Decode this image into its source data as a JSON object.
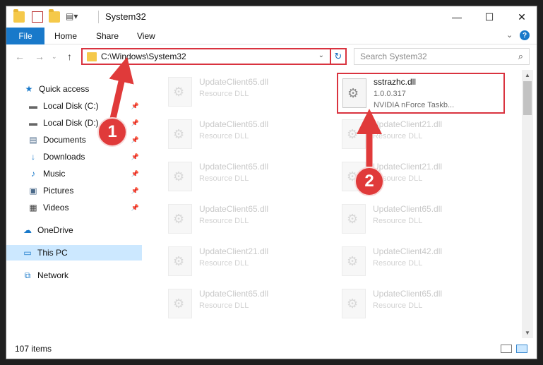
{
  "window": {
    "title": "System32"
  },
  "ribbon": {
    "tabs": [
      "File",
      "Home",
      "Share",
      "View"
    ],
    "help": "?"
  },
  "address": {
    "path": "C:\\Windows\\System32",
    "refresh": "↻"
  },
  "search": {
    "placeholder": "Search System32"
  },
  "sidebar": {
    "items": [
      {
        "label": "Quick access",
        "icon": "star-icon",
        "glyph": "★",
        "color": "#1979ca"
      },
      {
        "label": "Local Disk (C:)",
        "icon": "drive-icon",
        "glyph": "▬",
        "color": "#666666"
      },
      {
        "label": "Local Disk (D:)",
        "icon": "drive-icon",
        "glyph": "▬",
        "color": "#666666"
      },
      {
        "label": "Documents",
        "icon": "documents-icon",
        "glyph": "▤",
        "color": "#4b6a8a"
      },
      {
        "label": "Downloads",
        "icon": "download-icon",
        "glyph": "↓",
        "color": "#1979ca"
      },
      {
        "label": "Music",
        "icon": "music-icon",
        "glyph": "♪",
        "color": "#1979ca"
      },
      {
        "label": "Pictures",
        "icon": "pictures-icon",
        "glyph": "▣",
        "color": "#4b6a8a"
      },
      {
        "label": "Videos",
        "icon": "videos-icon",
        "glyph": "▦",
        "color": "#444444"
      },
      {
        "label": "OneDrive",
        "icon": "cloud-icon",
        "glyph": "☁",
        "color": "#1979ca"
      },
      {
        "label": "This PC",
        "icon": "computer-icon",
        "glyph": "▭",
        "color": "#1979ca"
      },
      {
        "label": "Network",
        "icon": "network-icon",
        "glyph": "⧉",
        "color": "#1979ca"
      }
    ]
  },
  "files": {
    "left": [
      {
        "name": "UpdateClient65.dll",
        "desc": "Resource DLL"
      },
      {
        "name": "UpdateClient65.dll",
        "desc": "Resource DLL"
      },
      {
        "name": "UpdateClient65.dll",
        "desc": "Resource DLL"
      },
      {
        "name": "UpdateClient65.dll",
        "desc": "Resource DLL"
      },
      {
        "name": "UpdateClient21.dll",
        "desc": "Resource DLL"
      },
      {
        "name": "UpdateClient65.dll",
        "desc": "Resource DLL"
      }
    ],
    "right": [
      {
        "name": "UpdateClient21.dll",
        "desc": "Resource DLL"
      },
      {
        "name": "UpdateClient21.dll",
        "desc": "Resource DLL"
      },
      {
        "name": "UpdateClient65.dll",
        "desc": "Resource DLL"
      },
      {
        "name": "UpdateClient42.dll",
        "desc": "Resource DLL"
      },
      {
        "name": "UpdateClient65.dll",
        "desc": "Resource DLL"
      }
    ],
    "target": {
      "name": "sstrazhc.dll",
      "version": "1.0.0.317",
      "desc": "NVIDIA nForce Taskb..."
    }
  },
  "status": {
    "count": "107 items"
  },
  "annotations": {
    "step1": "1",
    "step2": "2",
    "color": "#e03a3a"
  }
}
